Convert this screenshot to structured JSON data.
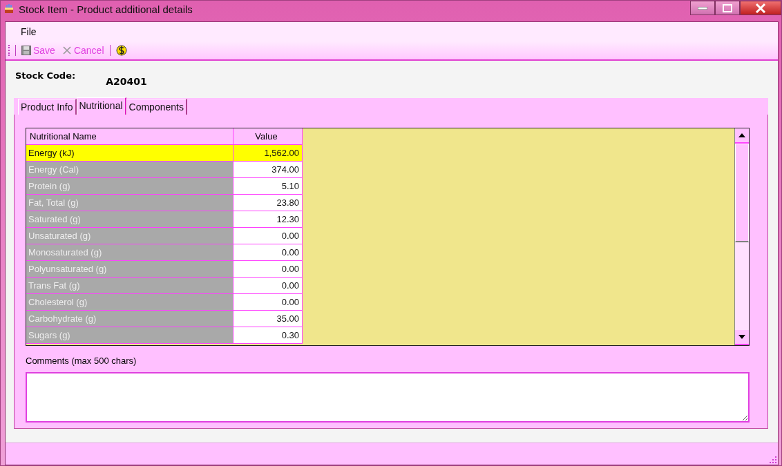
{
  "window": {
    "title": "Stock Item - Product additional details"
  },
  "menu": [
    "File"
  ],
  "toolbar": [
    {
      "kind": "save",
      "label": "Save"
    },
    {
      "kind": "cancel",
      "label": "Cancel"
    },
    {
      "kind": "dollar"
    }
  ],
  "stock_code": {
    "label": "Stock Code:",
    "value": "A20401"
  },
  "tabs": [
    {
      "label": "Product Info",
      "selected": false
    },
    {
      "label": "Nutritional",
      "selected": true
    },
    {
      "label": "Components",
      "selected": false
    }
  ],
  "table": {
    "columns": [
      "Nutritional Name",
      "Value"
    ],
    "rows": [
      {
        "name": "Energy (kJ)",
        "value": "1,562.00",
        "selected": true
      },
      {
        "name": "Energy (Cal)",
        "value": "374.00",
        "selected": false
      },
      {
        "name": "Protein (g)",
        "value": "5.10",
        "selected": false
      },
      {
        "name": "Fat, Total (g)",
        "value": "23.80",
        "selected": false
      },
      {
        "name": "Saturated (g)",
        "value": "12.30",
        "selected": false
      },
      {
        "name": "Unsaturated (g)",
        "value": "0.00",
        "selected": false
      },
      {
        "name": "Monosaturated (g)",
        "value": "0.00",
        "selected": false
      },
      {
        "name": "Polyunsaturated (g)",
        "value": "0.00",
        "selected": false
      },
      {
        "name": "Trans Fat (g)",
        "value": "0.00",
        "selected": false
      },
      {
        "name": "Cholesterol (g)",
        "value": "0.00",
        "selected": false
      },
      {
        "name": "Carbohydrate (g)",
        "value": "35.00",
        "selected": false
      },
      {
        "name": "Sugars (g)",
        "value": "0.30",
        "selected": false
      }
    ]
  },
  "comments": {
    "label": "Comments (max 500 chars)"
  }
}
